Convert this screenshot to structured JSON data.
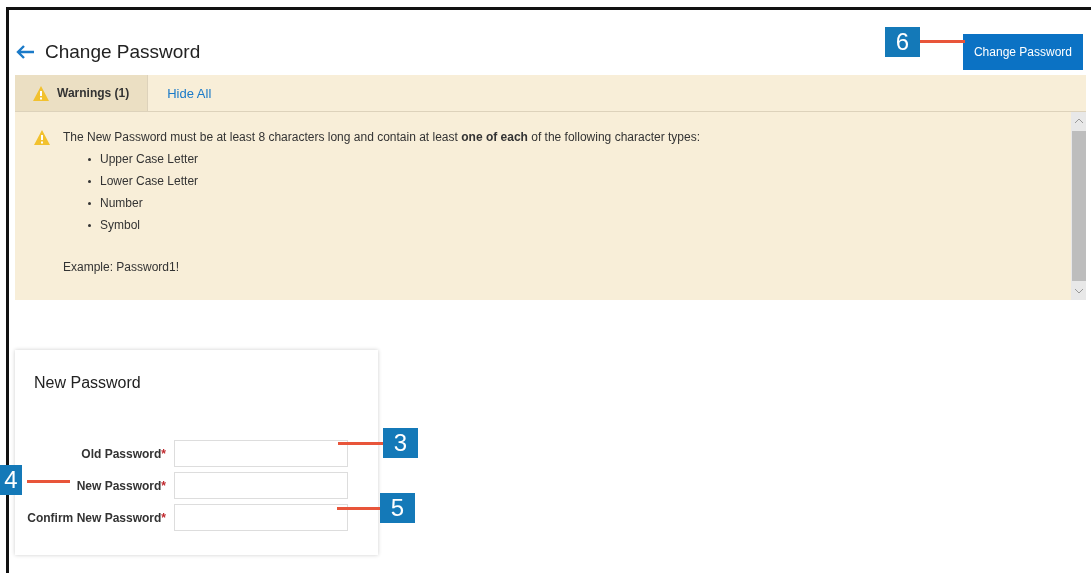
{
  "header": {
    "title": "Change Password",
    "action_button": "Change Password"
  },
  "warnings_bar": {
    "tab": "Warnings (1)",
    "link": "Hide All"
  },
  "warning": {
    "message": "The New Password must be at least 8 characters long and contain at least **one of each** of the following character types:",
    "items": [
      "Upper Case Letter",
      "Lower Case Letter",
      "Number",
      "Symbol"
    ],
    "example": "Example: Password1!"
  },
  "form": {
    "title": "New Password",
    "fields": [
      {
        "label": "Old Password",
        "required_mark": "*"
      },
      {
        "label": "New Password",
        "required_mark": "*"
      },
      {
        "label": "Confirm New Password",
        "required_mark": "*"
      }
    ]
  },
  "callouts": [
    {
      "label": "6"
    },
    {
      "label": "3"
    },
    {
      "label": "4"
    },
    {
      "label": "5"
    }
  ]
}
